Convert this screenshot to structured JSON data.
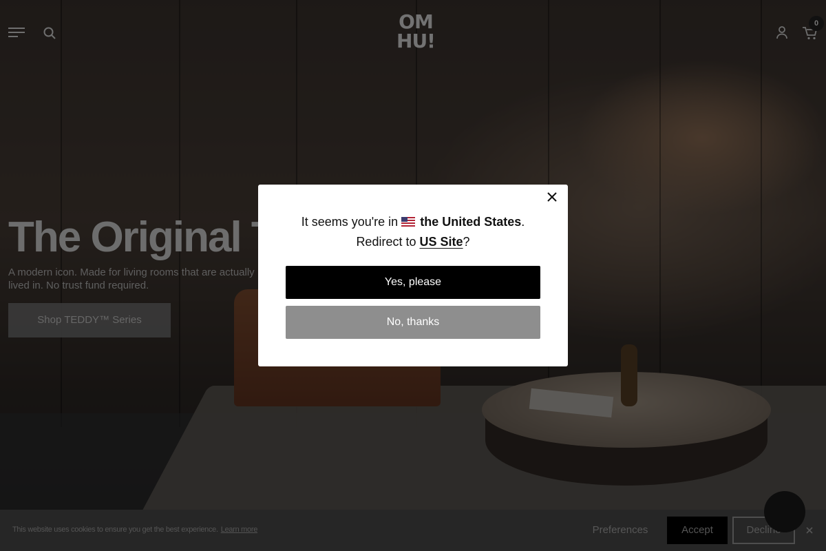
{
  "header": {
    "logo_line1": "OM",
    "logo_line2": "HU!",
    "cart_count": "0",
    "icons": [
      "menu-icon",
      "search-icon",
      "account-icon",
      "cart-icon"
    ]
  },
  "hero": {
    "title": "The Original TEDDY™",
    "subtitle": "A modern icon. Made for living rooms that are actually lived in. No trust fund required.",
    "cta_label": "Shop TEDDY™ Series"
  },
  "modal": {
    "line1_prefix": "It seems you're in",
    "country": "the United States",
    "line1_suffix": ".",
    "line2_prefix": "Redirect to",
    "site_link": "US Site",
    "line2_suffix": "?",
    "yes_label": "Yes, please",
    "no_label": "No, thanks",
    "flag_icon": "us-flag-icon",
    "close_icon": "close-icon"
  },
  "cookie": {
    "message": "This website uses cookies to ensure you get the best experience.",
    "learn_more": "Learn more",
    "preferences_label": "Preferences",
    "accept_label": "Accept",
    "decline_label": "Decline",
    "close_icon": "close-icon"
  },
  "colors": {
    "modal_bg": "#ffffff",
    "primary_button": "#000000",
    "secondary_button": "#8e8e8e",
    "overlay": "rgba(0,0,0,0.60)"
  }
}
